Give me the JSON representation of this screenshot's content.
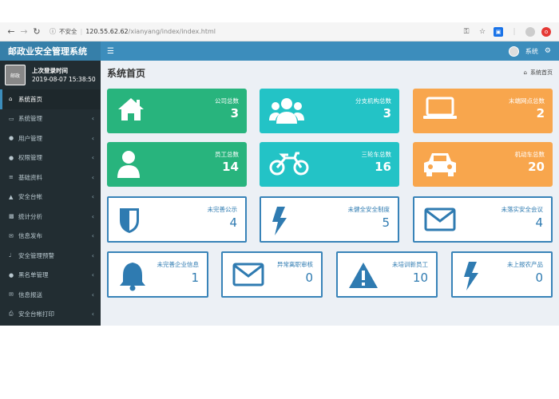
{
  "browser": {
    "insecure_label": "不安全",
    "url_host": "120.55.62.62",
    "url_path": "/xianyang/index/index.html"
  },
  "app": {
    "brand": "邮政业安全管理系统",
    "user_name": "系统"
  },
  "sidebar": {
    "last_login_label": "上次登录时间",
    "last_login_time": "2019-08-07 15:38:50",
    "avatar_text": "邮政",
    "items": [
      {
        "label": "系统首页",
        "icon": "home-icon",
        "active": true
      },
      {
        "label": "系统管理",
        "icon": "monitor-icon"
      },
      {
        "label": "用户管理",
        "icon": "users-icon"
      },
      {
        "label": "权限管理",
        "icon": "user-icon"
      },
      {
        "label": "基础资料",
        "icon": "list-icon"
      },
      {
        "label": "安全台帐",
        "icon": "warning-icon"
      },
      {
        "label": "统计分析",
        "icon": "bar-chart-icon"
      },
      {
        "label": "信息发布",
        "icon": "envelope-icon"
      },
      {
        "label": "安全管理预警",
        "icon": "volume-icon"
      },
      {
        "label": "黑名单管理",
        "icon": "user-icon"
      },
      {
        "label": "信息报送",
        "icon": "envelope-icon"
      },
      {
        "label": "安全台帐打印",
        "icon": "print-icon"
      }
    ]
  },
  "page": {
    "title": "系统首页",
    "breadcrumb": "系统首页"
  },
  "stats": {
    "company": {
      "label": "公司总数",
      "value": "3"
    },
    "branch": {
      "label": "分支机构总数",
      "value": "3"
    },
    "terminal": {
      "label": "末端网点总数",
      "value": "2"
    },
    "staff": {
      "label": "员工总数",
      "value": "14"
    },
    "tricycle": {
      "label": "三轮车总数",
      "value": "16"
    },
    "vehicle": {
      "label": "机动车总数",
      "value": "20"
    },
    "no_notice": {
      "label": "未完善公示",
      "value": "4"
    },
    "no_safety_system": {
      "label": "未健全安全制度",
      "value": "5"
    },
    "no_safety_meeting": {
      "label": "未落实安全会议",
      "value": "4"
    },
    "no_company_info": {
      "label": "未完善企业信息",
      "value": "1"
    },
    "abnormal_leave": {
      "label": "异常离职审核",
      "value": "0"
    },
    "untrained_staff": {
      "label": "未培训新员工",
      "value": "10"
    },
    "unreported_products": {
      "label": "未上报农产品",
      "value": "0"
    }
  },
  "colors": {
    "topbar": "#3c8dbc",
    "sidebar": "#222d32",
    "green": "#28b47d",
    "teal": "#23c3c6",
    "orange": "#f8a64d",
    "outline_blue": "#3883b8"
  }
}
